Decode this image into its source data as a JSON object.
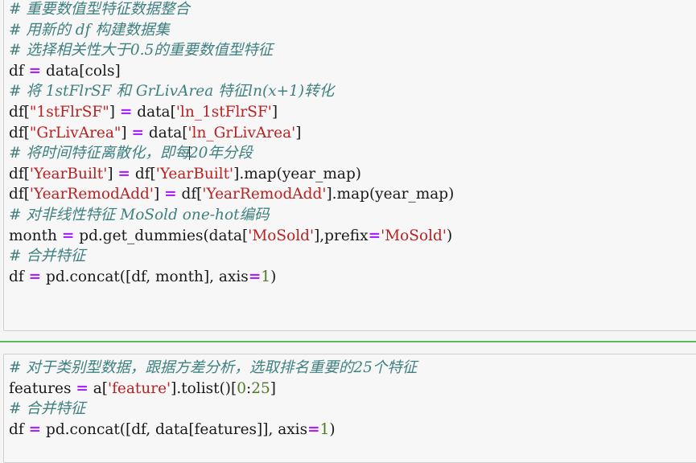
{
  "app": {
    "kind": "jupyter-notebook-code-cells",
    "background_color": "#f5f5f5",
    "cell_background_color": "#f7f7f7",
    "cell_border_color": "#cfcfcf",
    "divider_color": "#5cb85c"
  },
  "syntax_colors": {
    "comment": "#3f8080",
    "string": "#ba2121",
    "operator": "#aa22ff",
    "number": "#4f7a28",
    "plain": "#1a1a1a"
  },
  "cells": [
    {
      "name": "cell-one",
      "lines": [
        {
          "tokens": [
            {
              "t": "cm",
              "v": "# 重要数值型特征数据整合"
            }
          ]
        },
        {
          "tokens": [
            {
              "t": "cm",
              "v": "# 用新的 df 构建数据集"
            }
          ]
        },
        {
          "tokens": [
            {
              "t": "cm",
              "v": "# 选择相关性大于0.5的重要数值型特征"
            }
          ]
        },
        {
          "tokens": [
            {
              "t": "pl",
              "v": "df "
            },
            {
              "t": "op",
              "v": "="
            },
            {
              "t": "pl",
              "v": " data[cols]"
            }
          ]
        },
        {
          "tokens": [
            {
              "t": "cm",
              "v": "# 将 1stFlrSF 和 GrLivArea 特征ln(x+1)转化"
            }
          ]
        },
        {
          "tokens": [
            {
              "t": "pl",
              "v": "df["
            },
            {
              "t": "st",
              "v": "\"1stFlrSF\""
            },
            {
              "t": "pl",
              "v": "] "
            },
            {
              "t": "op",
              "v": "="
            },
            {
              "t": "pl",
              "v": " data["
            },
            {
              "t": "st",
              "v": "'ln_1stFlrSF'"
            },
            {
              "t": "pl",
              "v": "]"
            }
          ]
        },
        {
          "tokens": [
            {
              "t": "pl",
              "v": "df["
            },
            {
              "t": "st",
              "v": "\"GrLivArea\""
            },
            {
              "t": "pl",
              "v": "] "
            },
            {
              "t": "op",
              "v": "="
            },
            {
              "t": "pl",
              "v": " data["
            },
            {
              "t": "st",
              "v": "'ln_GrLivArea'"
            },
            {
              "t": "pl",
              "v": "]"
            }
          ]
        },
        {
          "tokens": [
            {
              "t": "cm",
              "v": "# 将时间特征离散化，即每"
            },
            {
              "t": "caret",
              "v": ""
            },
            {
              "t": "cm",
              "v": "20年分段"
            }
          ]
        },
        {
          "tokens": [
            {
              "t": "pl",
              "v": "df["
            },
            {
              "t": "st",
              "v": "'YearBuilt'"
            },
            {
              "t": "pl",
              "v": "] "
            },
            {
              "t": "op",
              "v": "="
            },
            {
              "t": "pl",
              "v": " df["
            },
            {
              "t": "st",
              "v": "'YearBuilt'"
            },
            {
              "t": "pl",
              "v": "].map(year_map)"
            }
          ]
        },
        {
          "tokens": [
            {
              "t": "pl",
              "v": "df["
            },
            {
              "t": "st",
              "v": "'YearRemodAdd'"
            },
            {
              "t": "pl",
              "v": "] "
            },
            {
              "t": "op",
              "v": "="
            },
            {
              "t": "pl",
              "v": " df["
            },
            {
              "t": "st",
              "v": "'YearRemodAdd'"
            },
            {
              "t": "pl",
              "v": "].map(year_map)"
            }
          ]
        },
        {
          "tokens": [
            {
              "t": "cm",
              "v": "# 对非线性特征 MoSold one-hot编码"
            }
          ]
        },
        {
          "tokens": [
            {
              "t": "pl",
              "v": "month "
            },
            {
              "t": "op",
              "v": "="
            },
            {
              "t": "pl",
              "v": " pd.get_dummies(data["
            },
            {
              "t": "st",
              "v": "'MoSold'"
            },
            {
              "t": "pl",
              "v": "],prefix"
            },
            {
              "t": "op",
              "v": "="
            },
            {
              "t": "st",
              "v": "'MoSold'"
            },
            {
              "t": "pl",
              "v": ")"
            }
          ]
        },
        {
          "tokens": [
            {
              "t": "cm",
              "v": "# 合并特征"
            }
          ]
        },
        {
          "tokens": [
            {
              "t": "pl",
              "v": "df "
            },
            {
              "t": "op",
              "v": "="
            },
            {
              "t": "pl",
              "v": " pd.concat([df, month], axis"
            },
            {
              "t": "op",
              "v": "="
            },
            {
              "t": "nu",
              "v": "1"
            },
            {
              "t": "pl",
              "v": ")"
            }
          ]
        }
      ]
    },
    {
      "name": "cell-two",
      "lines": [
        {
          "tokens": [
            {
              "t": "cm",
              "v": "# 对于类别型数据，跟据方差分析，选取排名重要的25个特征"
            }
          ]
        },
        {
          "tokens": [
            {
              "t": "pl",
              "v": "features "
            },
            {
              "t": "op",
              "v": "="
            },
            {
              "t": "pl",
              "v": " a["
            },
            {
              "t": "st",
              "v": "'feature'"
            },
            {
              "t": "pl",
              "v": "].tolist()["
            },
            {
              "t": "nu",
              "v": "0"
            },
            {
              "t": "pl",
              "v": ":"
            },
            {
              "t": "nu",
              "v": "25"
            },
            {
              "t": "pl",
              "v": "]"
            }
          ]
        },
        {
          "tokens": [
            {
              "t": "cm",
              "v": "# 合并特征"
            }
          ]
        },
        {
          "tokens": [
            {
              "t": "pl",
              "v": "df "
            },
            {
              "t": "op",
              "v": "="
            },
            {
              "t": "pl",
              "v": " pd.concat([df, data[features]], axis"
            },
            {
              "t": "op",
              "v": "="
            },
            {
              "t": "nu",
              "v": "1"
            },
            {
              "t": "pl",
              "v": ")"
            }
          ]
        }
      ]
    }
  ]
}
